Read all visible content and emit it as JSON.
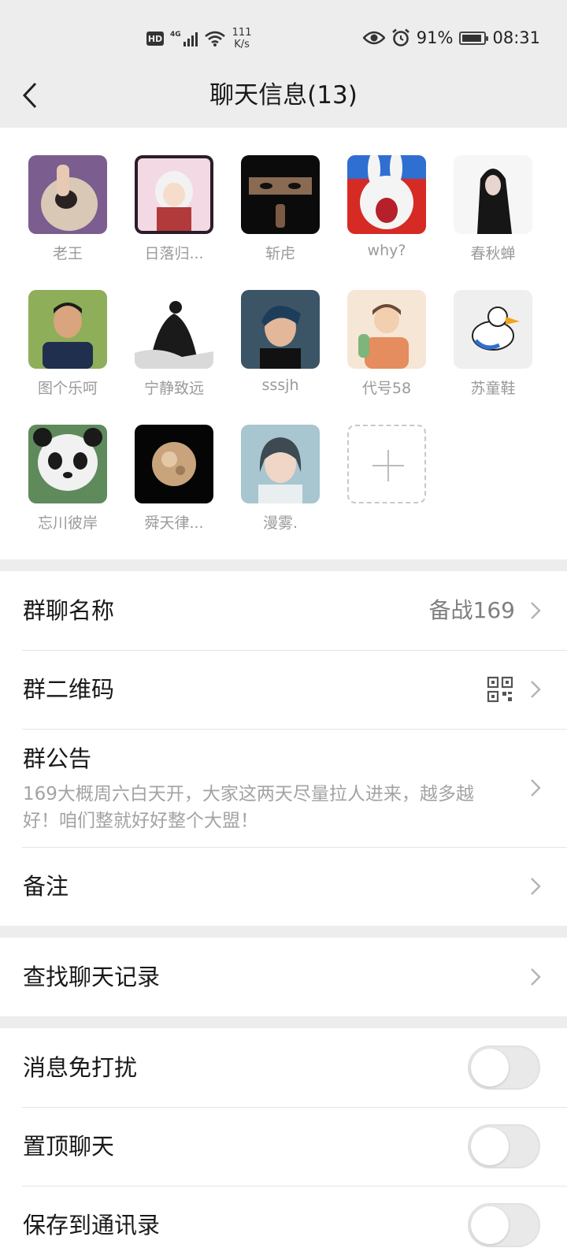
{
  "status_bar": {
    "hd": "HD",
    "network": "4G",
    "speed_value": "111",
    "speed_unit": "K/s",
    "battery": "91%",
    "time": "08:31"
  },
  "header": {
    "title": "聊天信息(13)"
  },
  "members": [
    {
      "name": "老王"
    },
    {
      "name": "日落归..."
    },
    {
      "name": "斩虍"
    },
    {
      "name": "why?"
    },
    {
      "name": "春秋蝉"
    },
    {
      "name": "图个乐呵"
    },
    {
      "name": "宁静致远"
    },
    {
      "name": "sssjh"
    },
    {
      "name": "代号58"
    },
    {
      "name": "苏童鞋"
    },
    {
      "name": "忘川彼岸"
    },
    {
      "name": "舜天律..."
    },
    {
      "name": "漫雾."
    }
  ],
  "settings": {
    "group_name_label": "群聊名称",
    "group_name_value": "备战169",
    "qr_label": "群二维码",
    "notice_label": "群公告",
    "notice_text": "169大概周六白天开，大家这两天尽量拉人进来，越多越好！咱们整就好好整个大盟！",
    "remark_label": "备注",
    "search_label": "查找聊天记录",
    "mute_label": "消息免打扰",
    "pin_label": "置顶聊天",
    "save_label": "保存到通讯录"
  },
  "colors": {
    "background": "#ededed",
    "card": "#ffffff",
    "secondary_text": "#9a9a9a"
  }
}
